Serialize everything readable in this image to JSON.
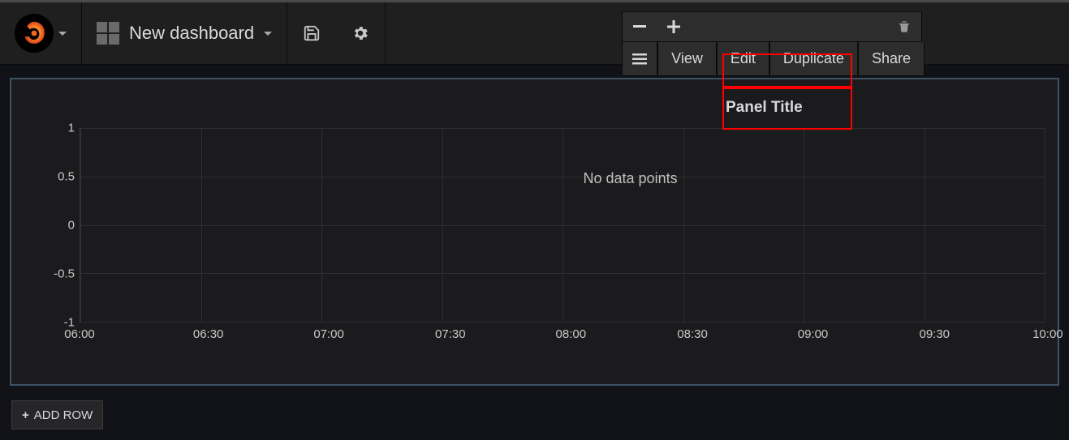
{
  "header": {
    "dashboard_name": "New dashboard"
  },
  "panel_menu": {
    "view": "View",
    "edit": "Edit",
    "duplicate": "Duplicate",
    "share": "Share"
  },
  "panel": {
    "title": "Panel Title",
    "no_data_message": "No data points"
  },
  "add_row_label": "ADD ROW",
  "chart_data": {
    "type": "line",
    "title": "Panel Title",
    "xlabel": "",
    "ylabel": "",
    "ylim": [
      -1.0,
      1.0
    ],
    "y_ticks": [
      1.0,
      0.5,
      0,
      -0.5,
      -1.0
    ],
    "x_ticks": [
      "06:00",
      "06:30",
      "07:00",
      "07:30",
      "08:00",
      "08:30",
      "09:00",
      "09:30",
      "10:00"
    ],
    "series": [],
    "note": "No data points"
  }
}
